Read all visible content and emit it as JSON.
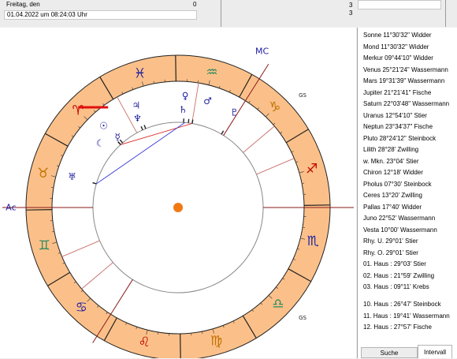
{
  "header": {
    "day_label": "Freitag, den",
    "datetime": "01.04.2022   um   08:24:03 Uhr",
    "left_counter": "0",
    "right_counter_a": "3",
    "right_counter_b": "3"
  },
  "chart": {
    "labels": {
      "mc": "MC",
      "ac": "Ac",
      "gs_top": "GS",
      "gs_bottom": "GS"
    },
    "colors": {
      "ring": "#fbc089",
      "sun_circle": "#ef7a14",
      "axis_line": "#8b1a1a",
      "house_line": "#c8706a",
      "red_marker": "#e01010",
      "aspect_red": "#dd2222",
      "aspect_blue": "#3a3ad8",
      "fire_sign": "#c00000",
      "earth_sign": "#c07000",
      "air_sign": "#2a8a60",
      "water_sign": "#2020a0",
      "planet": "#2020a0"
    },
    "zodiac_glyphs": [
      "♈",
      "♉",
      "♊",
      "♋",
      "♌",
      "♍",
      "♎",
      "♏",
      "♐",
      "♑",
      "♒",
      "♓"
    ],
    "planet_glyphs": {
      "sun": "☉",
      "moon": "☾",
      "mercury": "☿",
      "venus": "♀",
      "mars": "♂",
      "jupiter": "♃",
      "saturn": "♄",
      "uranus": "♅",
      "neptune": "♆",
      "pluto": "♇"
    }
  },
  "positions": {
    "planets": [
      "Sonne      11°30'32\" Widder",
      "Mond       11°30'32\" Widder",
      "Merkur    09°44'10\" Widder",
      "Venus      25°21'24\" Wassermann",
      "Mars        19°31'39\" Wassermann",
      "Jupiter     21°21'41\" Fische",
      "Saturn     22°03'48\" Wassermann",
      "Uranus    12°54'10\" Stier",
      "Neptun    23°34'37\" Fische",
      "Pluto       28°24'12\" Steinbock"
    ],
    "points": [
      "Lilith  28°28' Zwilling",
      "w. Mkn.  23°04' Stier",
      "Chiron   12°18' Widder",
      "Pholus   07°30' Steinbock",
      "Ceres    13°20' Zwilling",
      "Pallas   17°40' Widder",
      "Juno      22°52' Wassermann",
      "Vesta    10°00' Wassermann",
      "Rhy. U.    29°01' Stier",
      "Rhy. O.    29°01' Stier"
    ],
    "houses_a": [
      "01. Haus :  29°03' Stier",
      "02. Haus :  21°59' Zwilling",
      "03. Haus :  09°11' Krebs"
    ],
    "houses_b": [
      "10. Haus :  26°47' Steinbock",
      "11. Haus :  19°41' Wassermann",
      "12. Haus :  27°57' Fische"
    ]
  },
  "tabs": {
    "search": "Suche",
    "interval": "Intervall"
  }
}
